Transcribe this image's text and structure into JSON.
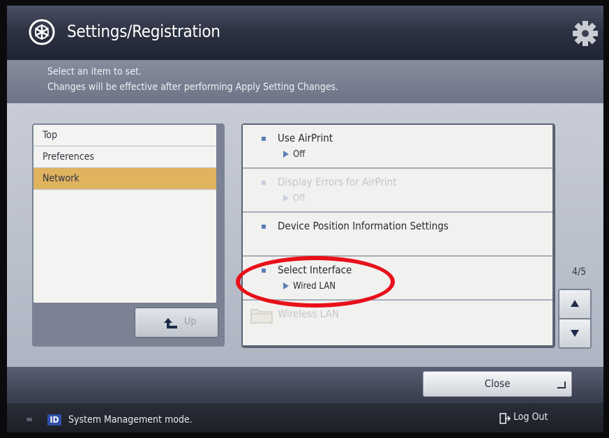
{
  "header": {
    "title": "Settings/Registration"
  },
  "instruction": {
    "line1": "Select an item to set.",
    "line2": "Changes will be effective after performing Apply Setting Changes."
  },
  "tree": {
    "items": [
      {
        "label": "Top",
        "selected": false
      },
      {
        "label": "Preferences",
        "selected": false
      },
      {
        "label": "Network",
        "selected": true
      }
    ],
    "up_label": "Up"
  },
  "settings": [
    {
      "label": "Use AirPrint",
      "value": "Off",
      "enabled": true
    },
    {
      "label": "Display Errors for AirPrint",
      "value": "Off",
      "enabled": false
    },
    {
      "label": "Device Position Information Settings",
      "value": "",
      "enabled": true
    },
    {
      "label": "Select Interface",
      "value": "Wired LAN",
      "enabled": true,
      "highlighted": true
    },
    {
      "label": "Wireless LAN",
      "value": "",
      "enabled": false,
      "type": "folder"
    }
  ],
  "pager": {
    "indicator": "4/5"
  },
  "footer": {
    "close_label": "Close",
    "id_badge": "ID",
    "mode_text": "System Management mode.",
    "logout_label": "Log Out"
  },
  "colors": {
    "selected_item": "#e0b35f",
    "annotation": "#e8101a",
    "bullet": "#5c7fb8"
  }
}
